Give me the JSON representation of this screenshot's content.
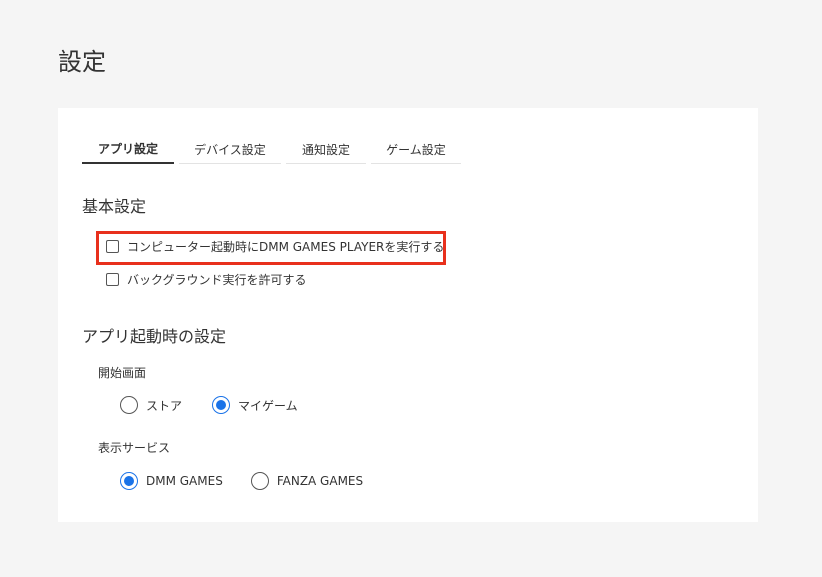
{
  "page": {
    "title": "設定"
  },
  "tabs": [
    {
      "label": "アプリ設定",
      "active": true
    },
    {
      "label": "デバイス設定",
      "active": false
    },
    {
      "label": "通知設定",
      "active": false
    },
    {
      "label": "ゲーム設定",
      "active": false
    }
  ],
  "basic_settings": {
    "title": "基本設定",
    "options": [
      {
        "label": "コンピューター起動時にDMM GAMES PLAYERを実行する",
        "checked": false
      },
      {
        "label": "バックグラウンド実行を許可する",
        "checked": false
      }
    ]
  },
  "startup_settings": {
    "title": "アプリ起動時の設定",
    "start_screen": {
      "label": "開始画面",
      "options": [
        {
          "label": "ストア",
          "selected": false
        },
        {
          "label": "マイゲーム",
          "selected": true
        }
      ]
    },
    "display_service": {
      "label": "表示サービス",
      "options": [
        {
          "label": "DMM GAMES",
          "selected": true
        },
        {
          "label": "FANZA GAMES",
          "selected": false
        }
      ]
    }
  },
  "colors": {
    "accent": "#1a73e8",
    "highlight": "#e8301c",
    "background": "#f5f5f5",
    "panel": "#ffffff"
  }
}
